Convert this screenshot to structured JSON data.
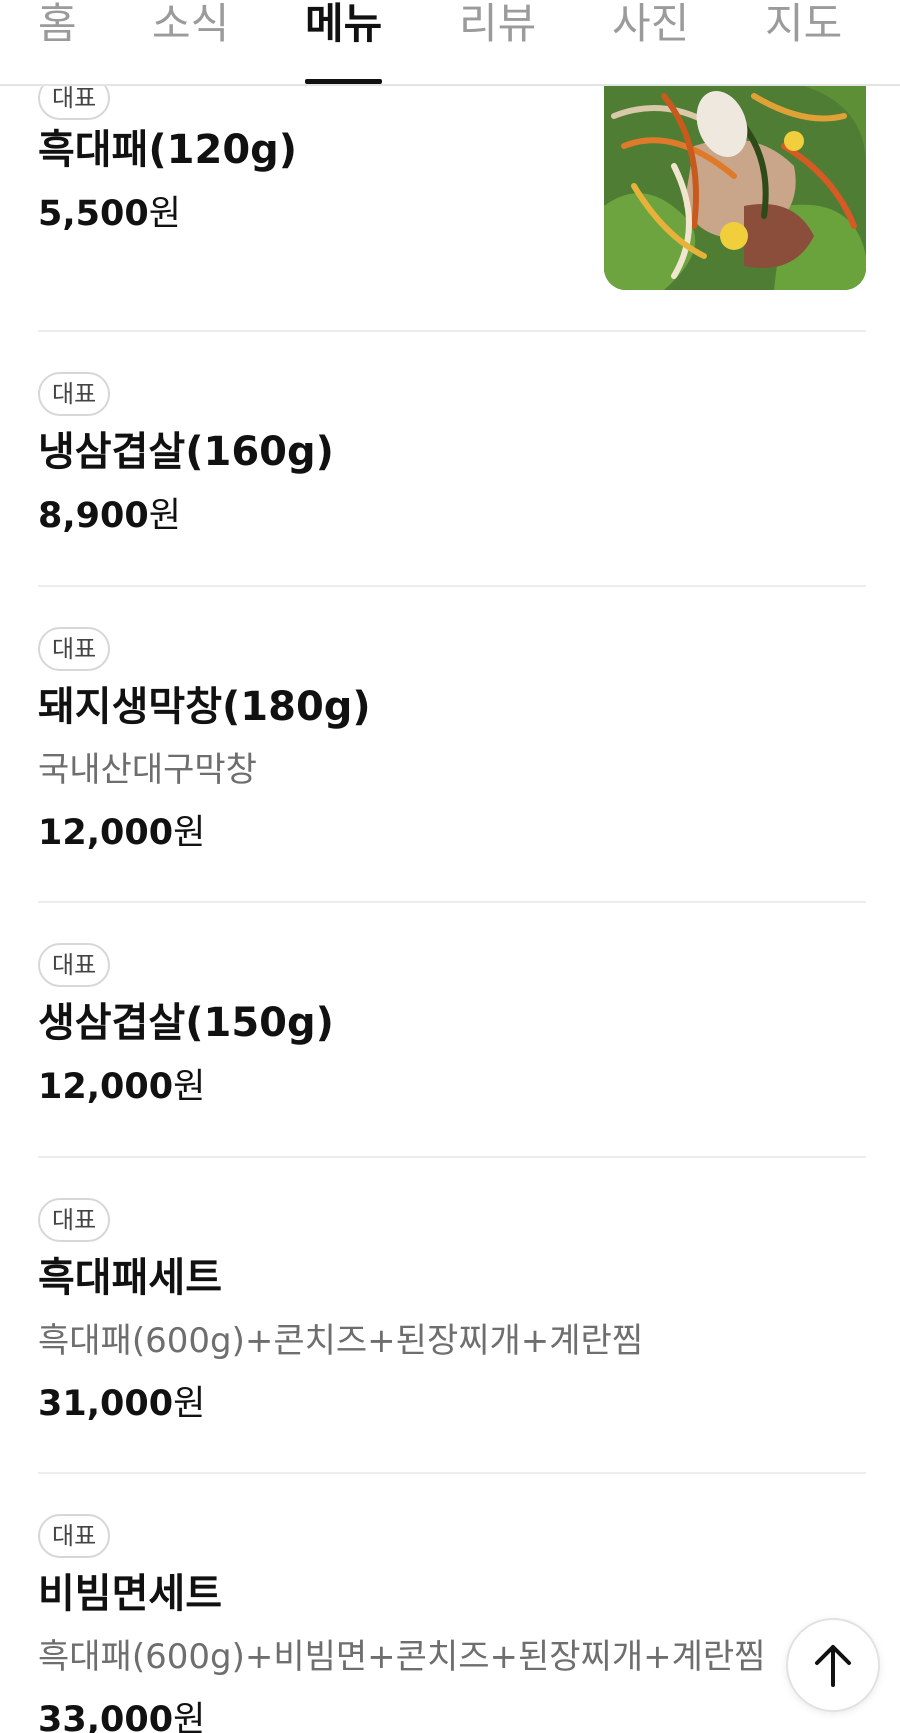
{
  "tabs": [
    {
      "label": "홈",
      "active": false
    },
    {
      "label": "소식",
      "active": false
    },
    {
      "label": "메뉴",
      "active": true
    },
    {
      "label": "리뷰",
      "active": false
    },
    {
      "label": "사진",
      "active": false
    },
    {
      "label": "지도",
      "active": false
    }
  ],
  "menu": [
    {
      "badge": "대표",
      "name": "흑대패(120g)",
      "desc": "",
      "price": "5,500",
      "unit": "원",
      "has_photo": true
    },
    {
      "badge": "대표",
      "name": "냉삼겹살(160g)",
      "desc": "",
      "price": "8,900",
      "unit": "원"
    },
    {
      "badge": "대표",
      "name": "돼지생막창(180g)",
      "desc": "국내산대구막창",
      "price": "12,000",
      "unit": "원"
    },
    {
      "badge": "대표",
      "name": "생삼겹살(150g)",
      "desc": "",
      "price": "12,000",
      "unit": "원"
    },
    {
      "badge": "대표",
      "name": "흑대패세트",
      "desc": "흑대패(600g)+콘치즈+된장찌개+계란찜",
      "price": "31,000",
      "unit": "원"
    },
    {
      "badge": "대표",
      "name": "비빔면세트",
      "desc": "흑대패(600g)+비빔면+콘치즈+된장찌개+계란찜",
      "price": "33,000",
      "unit": "원"
    }
  ],
  "icons": {
    "scroll_top": "arrow-up-icon",
    "food_photo": "food-photo"
  },
  "colors": {
    "active_tab": "#111111",
    "inactive_tab": "#9b9b9b",
    "badge_border": "#d7d7d7"
  }
}
